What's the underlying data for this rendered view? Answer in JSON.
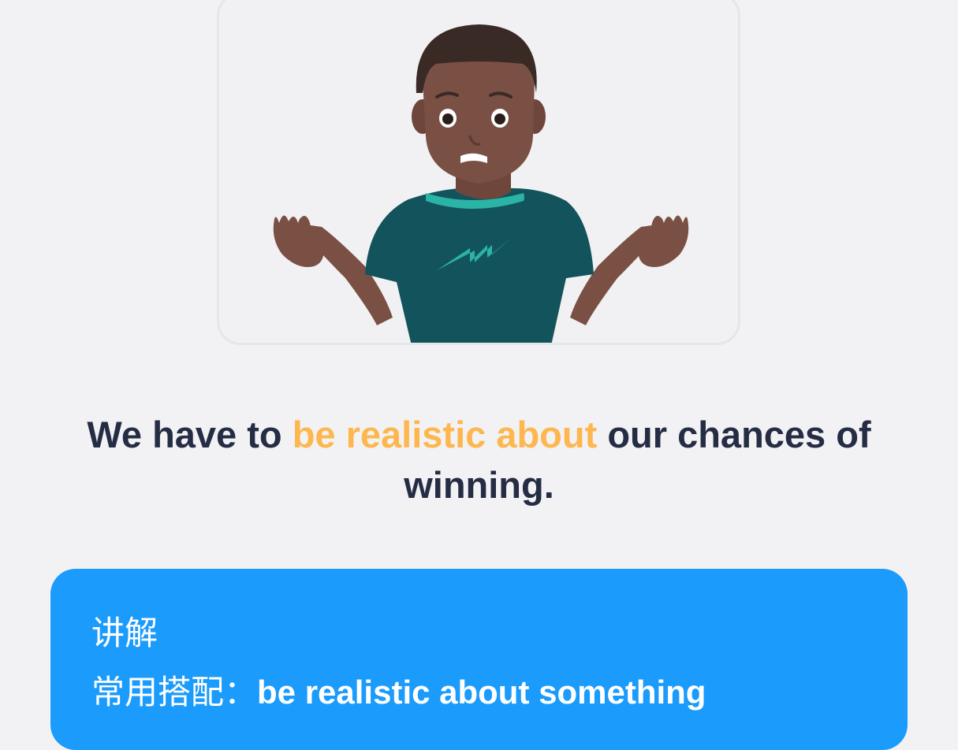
{
  "illustration": {
    "icon": "shrugging-man-illustration",
    "colors": {
      "skin": "#7a5044",
      "hair": "#3a2a26",
      "shirt": "#13545c",
      "collar": "#2bb3a6",
      "bolt": "#2bb3a6"
    }
  },
  "sentence": {
    "before": "We have to",
    "highlight": "be realistic about",
    "after": "our chances of winning."
  },
  "explanation": {
    "title": "讲解",
    "collocation_label": "常用搭配：",
    "collocation_phrase": "be realistic about something"
  },
  "colors": {
    "background": "#f2f2f4",
    "text": "#252d45",
    "highlight": "#fdb74e",
    "card": "#1b9bfc"
  }
}
